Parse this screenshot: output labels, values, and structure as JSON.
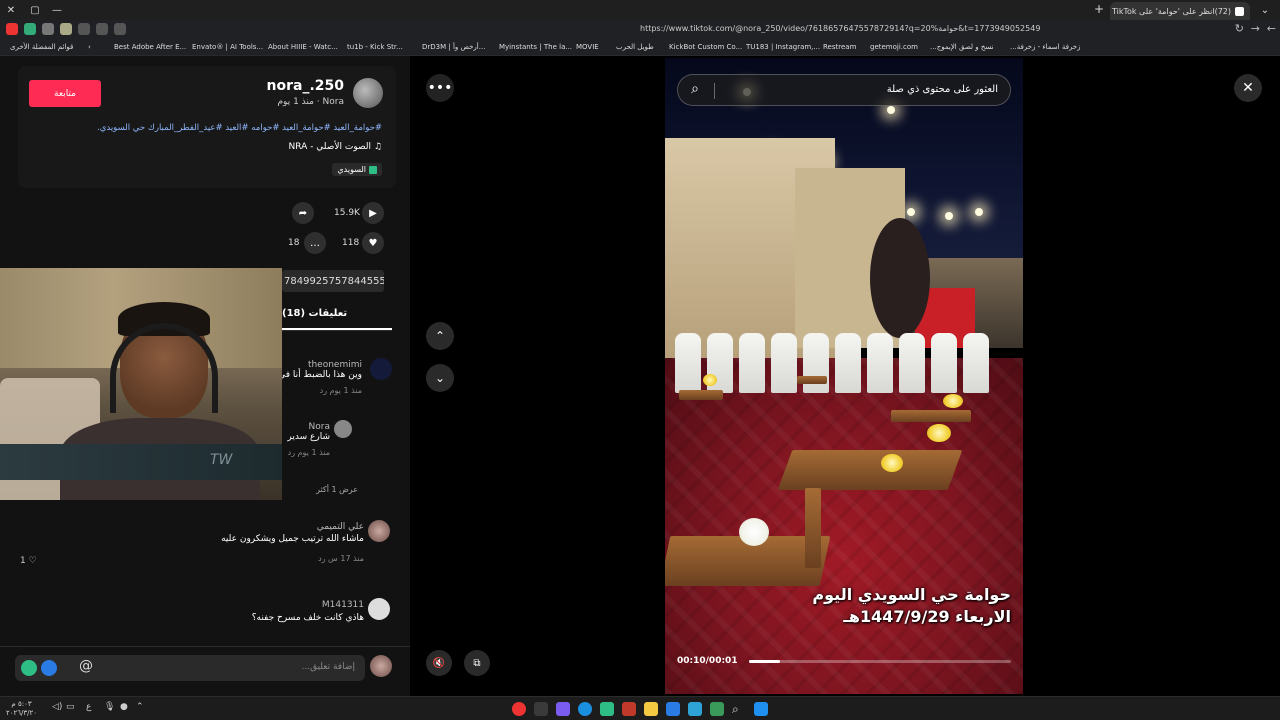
{
  "browser": {
    "tab_title": "(72)انظر على 'حوامة' على TikTok | ...",
    "url": "https://www.tiktok.com/@nora_250/video/7618657647557872914?q=20%حوامة&t=1773949052549",
    "bookmarks": [
      "قوائم المفضلة الأخرى",
      "Best Adobe After E...",
      "Envato® | AI Tools...",
      "About HIIIE - Watc...",
      "tu1b - Kick Str...",
      "DrD3M | أرخص وأ...",
      "Myinstants | The la...",
      "MOVIE",
      "طويل الحرب",
      "KickBot Custom Co...",
      "TU183 | Instagram,...",
      "Restream",
      "getemoji.com",
      "...نسخ و لصق الإيموج",
      "...زخرفة اسماء - زخرفة"
    ]
  },
  "author": {
    "username": "nora_.250",
    "display_meta": "Nora · منذ 1 يوم",
    "follow_label": "متابعة",
    "description": "#حوامة_العيد #حوامة_العيد #حوامه #العيد #عيد_الفطر_المبارك حي السويدي.",
    "sound": "الصوت الأصلي - NRA",
    "location": "السويدي"
  },
  "actions": {
    "likes": "118",
    "comments": "18",
    "shares": "15.9K",
    "link_text": "7849925757844555"
  },
  "comments_tab": "تعليقات (18)",
  "comments": [
    {
      "user": "theonemimi",
      "text": "وين هذا بالضبط أنا في",
      "meta": "منذ 1 يوم   رد"
    },
    {
      "user": "Nora",
      "text": "شارع سدير",
      "meta": "منذ 1 يوم   رد"
    },
    {
      "user": "",
      "text": "عرض 1 أكثر",
      "meta": ""
    },
    {
      "user": "علي التميمي",
      "text": "ماشاء الله ترتيب جميل ويشكرون عليه",
      "meta": "منذ 17 س   رد",
      "likes": "1"
    },
    {
      "user": "M141311",
      "text": "هاذي كانت خلف مسرح جفنه؟",
      "meta": ""
    }
  ],
  "comment_input_placeholder": "إضافة تعليق...",
  "comment_at": "@",
  "video": {
    "search_placeholder": "العثور على محتوى ذي صلة",
    "caption_line1": "حوامة حي السويدي اليوم",
    "caption_line2": "الاربعاء 1447/9/29هـ",
    "time": "00:10/00:01",
    "progress": 0.12
  },
  "webcam_banner_text": "TW",
  "taskbar": {
    "time": "٥:٠٣ م",
    "date": "٢٠٢٦/٣/٢٠"
  },
  "colors": {
    "accent": "#fe2c55",
    "hashtag": "#8fb8ff"
  }
}
